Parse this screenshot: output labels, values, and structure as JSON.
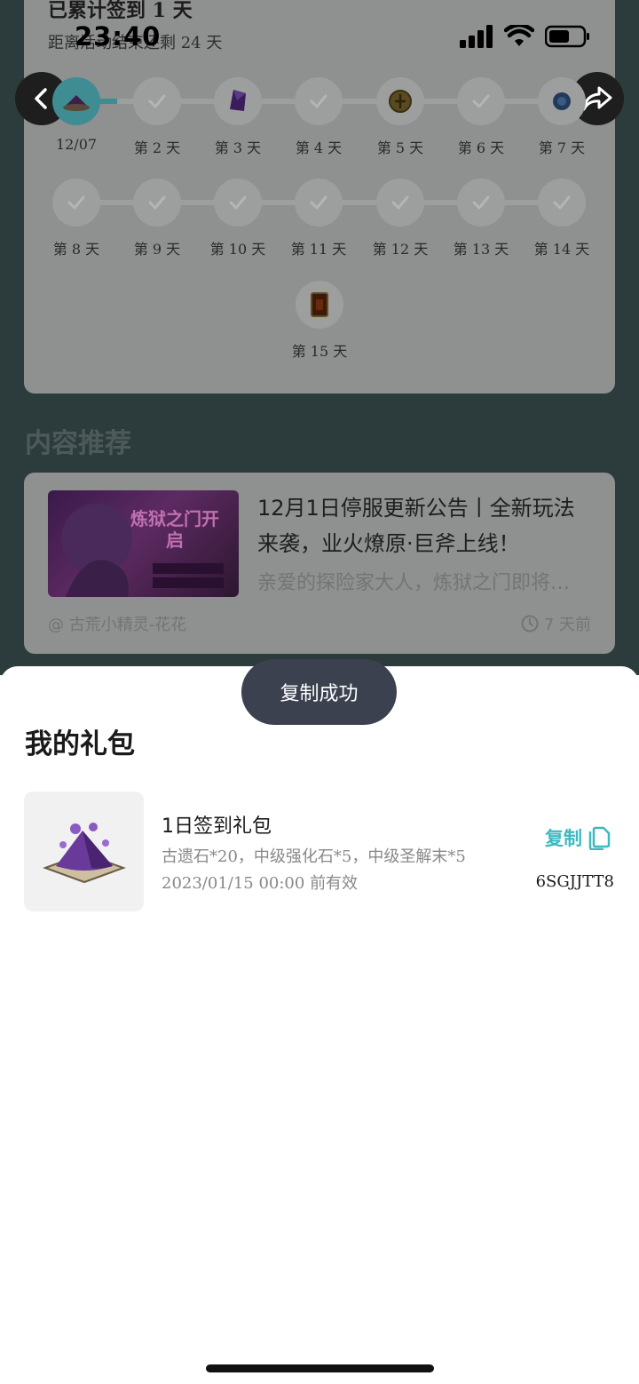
{
  "status_bar": {
    "time": "23:40"
  },
  "checkin": {
    "title": "已累计签到 1 天",
    "remaining": "距离活动结束还剩 24 天",
    "days": [
      {
        "label": "12/07"
      },
      {
        "label": "第 2 天"
      },
      {
        "label": "第 3 天"
      },
      {
        "label": "第 4 天"
      },
      {
        "label": "第 5 天"
      },
      {
        "label": "第 6 天"
      },
      {
        "label": "第 7 天"
      },
      {
        "label": "第 8 天"
      },
      {
        "label": "第 9 天"
      },
      {
        "label": "第 10 天"
      },
      {
        "label": "第 11 天"
      },
      {
        "label": "第 12 天"
      },
      {
        "label": "第 13 天"
      },
      {
        "label": "第 14 天"
      },
      {
        "label": "第 15 天"
      }
    ]
  },
  "content": {
    "section_title": "内容推荐",
    "article": {
      "title": "12月1日停服更新公告丨全新玩法来袭，业火燎原·巨斧上线！",
      "summary": "亲爱的探险家大人，炼狱之门即将…",
      "author": "@ 古荒小精灵-花花",
      "time": "7 天前",
      "thumb_text": "炼狱之门开启"
    }
  },
  "toast": {
    "text": "复制成功"
  },
  "gift_sheet": {
    "title": "我的礼包",
    "gift": {
      "name": "1日签到礼包",
      "items": "古遗石*20，中级强化石*5，中级圣解末*5",
      "valid_until": "2023/01/15 00:00 前有效",
      "copy_label": "复制",
      "code": "6SGJJTT8"
    }
  },
  "colors": {
    "accent": "#3fb9c0",
    "toast_bg": "#3b414f",
    "overlay_bg": "#2c3c3c"
  }
}
